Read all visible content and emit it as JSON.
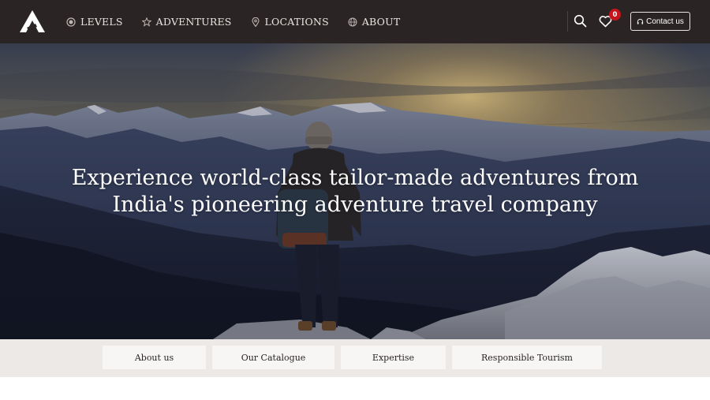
{
  "header": {
    "nav": [
      {
        "label": "LEVELS",
        "icon": "gauge-icon"
      },
      {
        "label": "ADVENTURES",
        "icon": "star-icon"
      },
      {
        "label": "LOCATIONS",
        "icon": "map-pin-icon"
      },
      {
        "label": "ABOUT",
        "icon": "globe-icon"
      }
    ],
    "wishlist_count": "0",
    "contact_label": "Contact us"
  },
  "hero": {
    "line1": "Experience world-class tailor-made adventures from",
    "line2": "India's pioneering adventure travel company"
  },
  "subnav": {
    "items": [
      {
        "label": "About us"
      },
      {
        "label": "Our Catalogue"
      },
      {
        "label": "Expertise"
      },
      {
        "label": "Responsible Tourism"
      }
    ]
  },
  "colors": {
    "header_bg": "#2b2425",
    "badge": "#c4161c",
    "subnav_bg": "#ece9e7",
    "button_bg": "#f7f6f5"
  }
}
